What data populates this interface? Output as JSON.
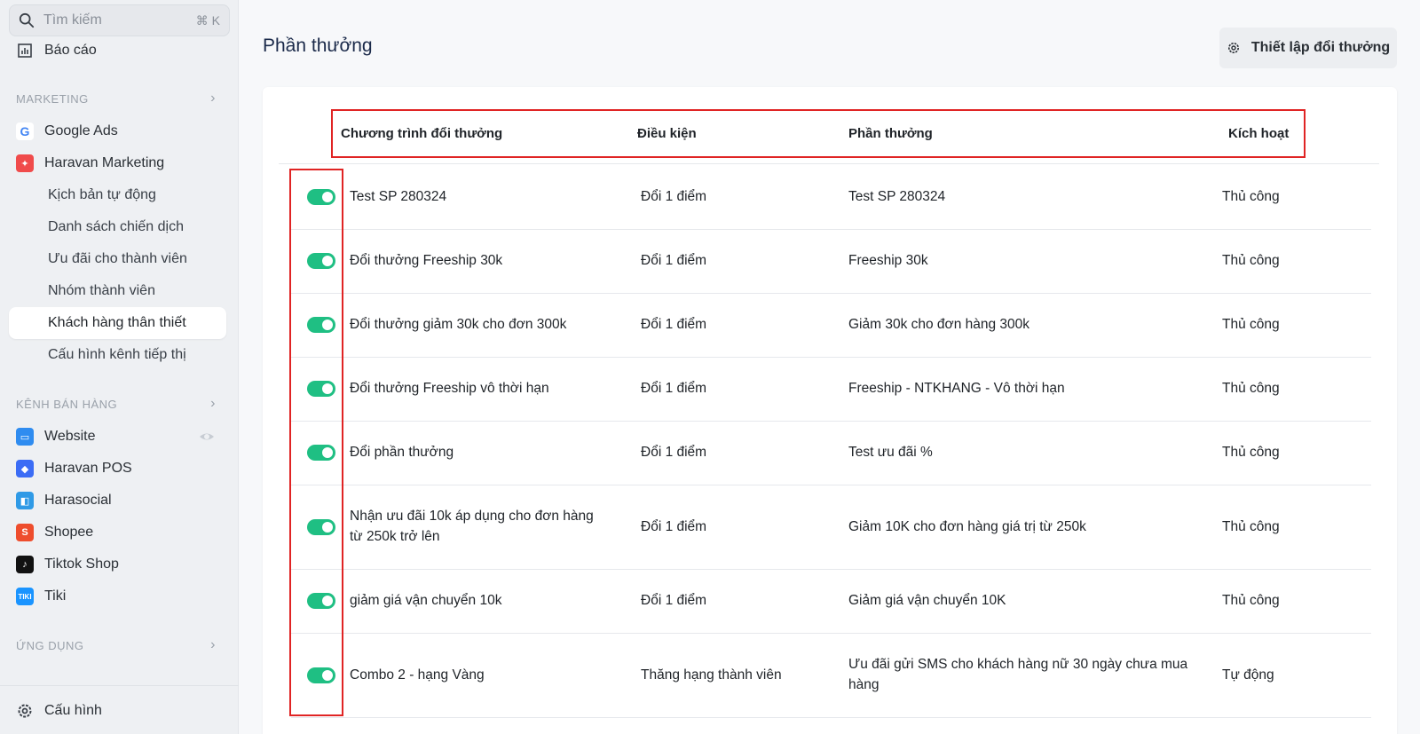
{
  "sidebar": {
    "search": {
      "placeholder": "Tìm kiếm",
      "shortcut": "⌘ K"
    },
    "report_item": "Báo cáo",
    "marketing_section": "MARKETING",
    "marketing_items": [
      {
        "label": "Google Ads",
        "icon": "google-icon"
      },
      {
        "label": "Haravan Marketing",
        "icon": "haravan-marketing-icon"
      }
    ],
    "marketing_sub_items": [
      "Kịch bản tự động",
      "Danh sách chiến dịch",
      "Ưu đãi cho thành viên",
      "Nhóm thành viên",
      "Khách hàng thân thiết",
      "Cấu hình kênh tiếp thị"
    ],
    "active_sub_item": "Khách hàng thân thiết",
    "sales_section": "KÊNH BÁN HÀNG",
    "sales_items": [
      {
        "label": "Website",
        "icon": "website-icon",
        "color": "#2f8cf0"
      },
      {
        "label": "Haravan POS",
        "icon": "pos-icon",
        "color": "#3b6cf5"
      },
      {
        "label": "Harasocial",
        "icon": "harasocial-icon",
        "color": "#2f9ae6"
      },
      {
        "label": "Shopee",
        "icon": "shopee-icon",
        "color": "#ee4d2d"
      },
      {
        "label": "Tiktok Shop",
        "icon": "tiktok-icon",
        "color": "#111111"
      },
      {
        "label": "Tiki",
        "icon": "tiki-icon",
        "color": "#1a94ff"
      }
    ],
    "apps_section": "ỨNG DỤNG",
    "settings_item": "Cấu hình"
  },
  "main": {
    "title": "Phần thưởng",
    "setup_button": "Thiết lập đổi thưởng",
    "columns": [
      "Chương trình đổi thưởng",
      "Điều kiện",
      "Phần thưởng",
      "Kích hoạt"
    ],
    "rows": [
      {
        "name": "Test SP 280324",
        "condition": "Đổi 1 điểm",
        "reward": "Test SP 280324",
        "activation": "Thủ công",
        "enabled": true
      },
      {
        "name": "Đổi thưởng Freeship 30k",
        "condition": "Đổi 1 điểm",
        "reward": "Freeship 30k",
        "activation": "Thủ công",
        "enabled": true
      },
      {
        "name": "Đổi thưởng giảm 30k cho đơn 300k",
        "condition": "Đổi 1 điểm",
        "reward": "Giảm 30k cho đơn hàng 300k",
        "activation": "Thủ công",
        "enabled": true
      },
      {
        "name": "Đổi thưởng Freeship vô thời hạn",
        "condition": "Đổi 1 điểm",
        "reward": "Freeship - NTKHANG - Vô thời hạn",
        "activation": "Thủ công",
        "enabled": true
      },
      {
        "name": "Đổi phần thưởng",
        "condition": "Đổi 1 điểm",
        "reward": "Test ưu đãi %",
        "activation": "Thủ công",
        "enabled": true
      },
      {
        "name": "Nhận ưu đãi 10k áp dụng cho đơn hàng từ 250k trở lên",
        "condition": "Đổi 1 điểm",
        "reward": "Giảm 10K cho đơn hàng giá trị từ 250k",
        "activation": "Thủ công",
        "enabled": true
      },
      {
        "name": "giảm giá vận chuyển 10k",
        "condition": "Đổi 1 điểm",
        "reward": "Giảm giá vận chuyển 10K",
        "activation": "Thủ công",
        "enabled": true
      },
      {
        "name": "Combo 2 - hạng Vàng",
        "condition": "Thăng hạng thành viên",
        "reward": "Ưu đãi gửi SMS cho khách hàng nữ 30 ngày chưa mua hàng",
        "activation": "Tự động",
        "enabled": true
      }
    ]
  },
  "colors": {
    "toggle_on": "#1fbf83",
    "highlight": "#e02424"
  }
}
